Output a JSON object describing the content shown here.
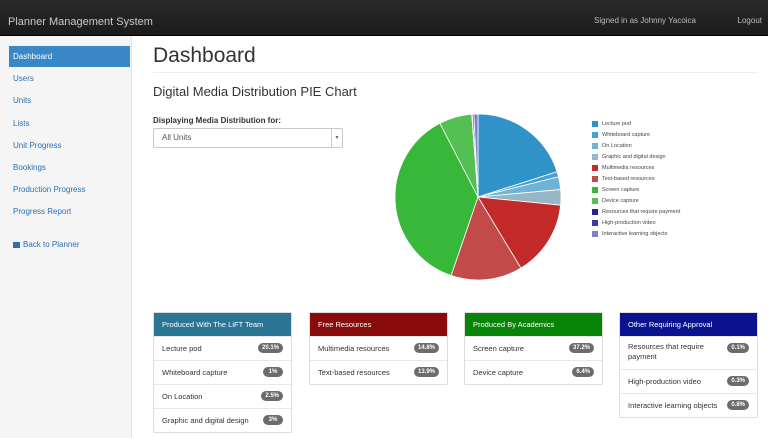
{
  "navbar": {
    "brand": "Planner Management System",
    "signed_in": "Signed in as Johnny Yacoica",
    "logout": "Logout"
  },
  "sidebar": {
    "items": [
      {
        "label": "Dashboard",
        "active": true
      },
      {
        "label": "Users"
      },
      {
        "label": "Units"
      },
      {
        "label": "Lists"
      },
      {
        "label": "Unit Progress"
      },
      {
        "label": "Bookings"
      },
      {
        "label": "Production Progress"
      },
      {
        "label": "Progress Report"
      }
    ],
    "back_label": "Back to Planner"
  },
  "main": {
    "title": "Dashboard",
    "subtitle": "Digital Media Distribution PIE Chart",
    "filter_label": "Displaying Media Distribution for:",
    "filter_value": "All Units"
  },
  "chart_data": {
    "type": "pie",
    "series": [
      {
        "name": "Lecture pod",
        "value": 20.1,
        "color": "#2f93c8"
      },
      {
        "name": "Whiteboard capture",
        "value": 1,
        "color": "#4aa0d0"
      },
      {
        "name": "On Location",
        "value": 2.5,
        "color": "#6fb3d8"
      },
      {
        "name": "Graphic and digital design",
        "value": 3,
        "color": "#95b7c6"
      },
      {
        "name": "Multimedia resources",
        "value": 14.8,
        "color": "#c22a2a"
      },
      {
        "name": "Text-based resources",
        "value": 13.9,
        "color": "#c24a4a"
      },
      {
        "name": "Screen capture",
        "value": 37.2,
        "color": "#38b838"
      },
      {
        "name": "Device capture",
        "value": 6.4,
        "color": "#54c054"
      },
      {
        "name": "Resources that require payment",
        "value": 0.1,
        "color": "#22229a"
      },
      {
        "name": "High-production video",
        "value": 0.3,
        "color": "#3a3aa8"
      },
      {
        "name": "Interactive learning objects",
        "value": 0.8,
        "color": "#8080c8"
      }
    ]
  },
  "panels": [
    {
      "title": "Produced With The LiFT Team",
      "color": "#2a7494",
      "rows": [
        {
          "label": "Lecture pod",
          "value": "20.1%"
        },
        {
          "label": "Whiteboard capture",
          "value": "1%"
        },
        {
          "label": "On Location",
          "value": "2.5%"
        },
        {
          "label": "Graphic and digital design",
          "value": "3%"
        }
      ]
    },
    {
      "title": "Free Resources",
      "color": "#8a0b0b",
      "rows": [
        {
          "label": "Multimedia resources",
          "value": "14.8%"
        },
        {
          "label": "Text-based resources",
          "value": "13.9%"
        }
      ]
    },
    {
      "title": "Produced By Academics",
      "color": "#078407",
      "rows": [
        {
          "label": "Screen capture",
          "value": "37.2%"
        },
        {
          "label": "Device capture",
          "value": "6.4%"
        }
      ]
    },
    {
      "title": "Other Requiring Approval",
      "color": "#0b1290",
      "rows": [
        {
          "label": "Resources that require payment",
          "value": "0.1%"
        },
        {
          "label": "High-production video",
          "value": "0.3%"
        },
        {
          "label": "Interactive learning objects",
          "value": "0.8%"
        }
      ]
    }
  ]
}
